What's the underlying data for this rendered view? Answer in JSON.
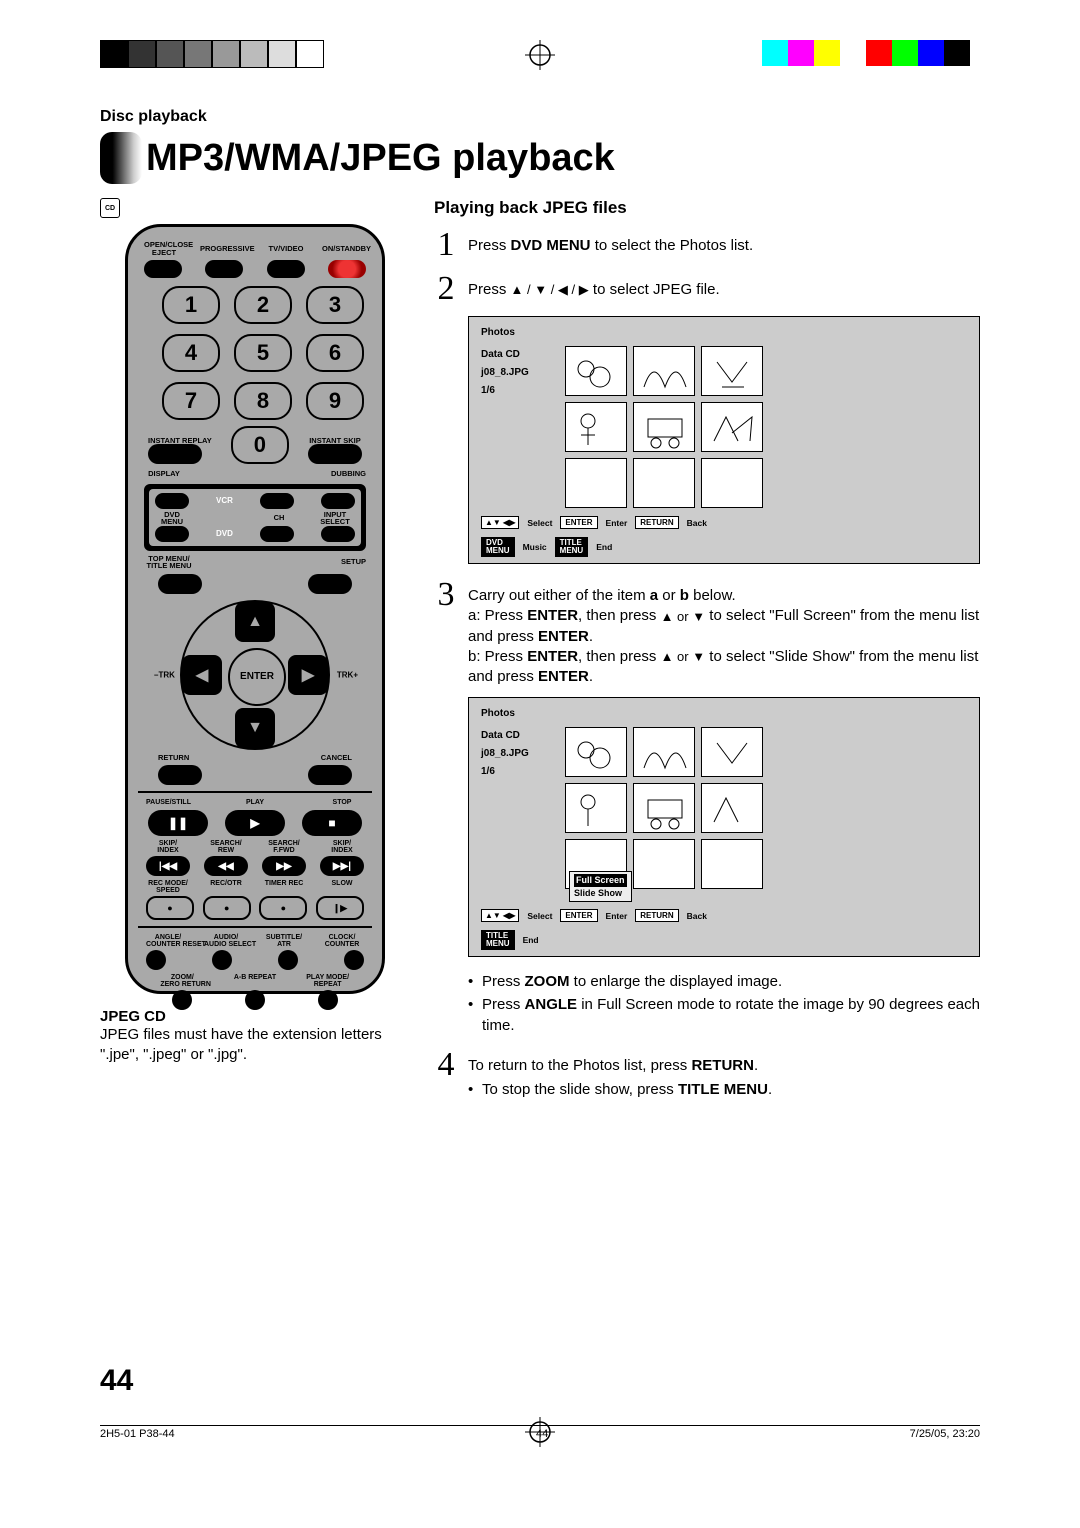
{
  "registration": {
    "mono_swatches": [
      "#000",
      "#333",
      "#555",
      "#777",
      "#999",
      "#bbb",
      "#ddd",
      "#fff"
    ],
    "color_swatches": [
      "#0ff",
      "#f0f",
      "#ff0",
      "#fff",
      "#f00",
      "#0f0",
      "#00f",
      "#000"
    ]
  },
  "header": {
    "section": "Disc playback",
    "title": "MP3/WMA/JPEG playback",
    "disc_badge": "CD"
  },
  "remote": {
    "top_labels": {
      "open_close": "OPEN/CLOSE",
      "eject": "EJECT",
      "progressive": "PROGRESSIVE",
      "tv_video": "TV/VIDEO",
      "on_standby": "ON/STANDBY"
    },
    "numbers": [
      "1",
      "2",
      "3",
      "4",
      "5",
      "6",
      "7",
      "8",
      "9"
    ],
    "zero": "0",
    "instant_replay": "INSTANT REPLAY",
    "instant_skip": "INSTANT SKIP",
    "display": "DISPLAY",
    "dubbing": "DUBBING",
    "vcr": "VCR",
    "dvd_menu": "DVD MENU",
    "ch": "CH",
    "input_select": "INPUT SELECT",
    "dvd": "DVD",
    "top_menu": "TOP MENU/\nTITLE MENU",
    "setup": "SETUP",
    "trk_minus": "–TRK",
    "enter": "ENTER",
    "trk_plus": "TRK+",
    "return": "RETURN",
    "cancel": "CANCEL",
    "transport": {
      "pause": "PAUSE/STILL",
      "play": "PLAY",
      "stop": "STOP"
    },
    "search": {
      "skip_index_l": "SKIP/\nINDEX",
      "search_rew": "SEARCH/\nREW",
      "search_fwd": "SEARCH/\nF.FWD",
      "skip_index_r": "SKIP/\nINDEX"
    },
    "rec_row": {
      "rec_mode": "REC MODE/\nSPEED",
      "rec_otr": "REC/OTR",
      "timer_rec": "TIMER REC",
      "slow": "SLOW"
    },
    "bottom_labels_1": {
      "angle": "ANGLE/\nCOUNTER RESET",
      "audio": "AUDIO/\nAUDIO SELECT",
      "subtitle": "SUBTITLE/\nATR",
      "clock": "CLOCK/\nCOUNTER"
    },
    "bottom_labels_2": {
      "zoom": "ZOOM/\nZERO RETURN",
      "ab": "A-B REPEAT",
      "play_mode": "PLAY MODE/\nREPEAT"
    }
  },
  "jpeg_cd": {
    "heading": "JPEG CD",
    "body": "JPEG files must have the extension letters \".jpe\", \".jpeg\" or \".jpg\"."
  },
  "right": {
    "subhead": "Playing back JPEG files",
    "step1": {
      "n": "1",
      "pre": "Press ",
      "b1": "DVD MENU",
      "post": " to select the Photos list."
    },
    "step2": {
      "n": "2",
      "pre": "Press ",
      "arrows": "▲ / ▼ / ◀ / ▶",
      "post": " to select JPEG file."
    },
    "osd1": {
      "title": "Photos",
      "left": {
        "l1": "Data CD",
        "l2": "j08_8.JPG",
        "l3": "1/6"
      },
      "footer": {
        "arrows": "▲▼ ◀▶",
        "select": "Select",
        "enter_key": "ENTER",
        "enter": "Enter",
        "return_key": "RETURN",
        "back": "Back",
        "dvd_menu_key": "DVD\nMENU",
        "music": "Music",
        "title_menu_key": "TITLE\nMENU",
        "end": "End"
      }
    },
    "step3": {
      "n": "3",
      "line1": "Carry out either of the item a or b below.",
      "a_pre": "a:  Press ",
      "a_b1": "ENTER",
      "a_mid1": ", then press ",
      "a_arrows": "▲ or ▼",
      "a_mid2": " to select \"Full Screen\" from the menu list and press ",
      "a_b2": "ENTER",
      "a_end": ".",
      "b_pre": "b:  Press ",
      "b_b1": "ENTER",
      "b_mid1": ", then press ",
      "b_arrows": "▲ or ▼",
      "b_mid2": " to select \"Slide Show\" from the menu list and press ",
      "b_b2": "ENTER",
      "b_end": "."
    },
    "osd2": {
      "title": "Photos",
      "left": {
        "l1": "Data CD",
        "l2": "j08_8.JPG",
        "l3": "1/6"
      },
      "menu": {
        "full": "Full Screen",
        "slide": "Slide Show"
      },
      "footer": {
        "arrows": "▲▼ ◀▶",
        "select": "Select",
        "enter_key": "ENTER",
        "enter": "Enter",
        "return_key": "RETURN",
        "back": "Back",
        "title_menu_key": "TITLE\nMENU",
        "end": "End"
      }
    },
    "bullets_a": [
      "Press ZOOM to enlarge the displayed image.",
      "Press ANGLE in Full Screen mode to rotate the image by 90 degrees each time."
    ],
    "step4": {
      "n": "4",
      "line1_pre": "To return to the Photos list, press ",
      "line1_b": "RETURN",
      "line1_end": ".",
      "bullet_pre": "To stop the slide show, press ",
      "bullet_b": "TITLE MENU",
      "bullet_end": "."
    }
  },
  "page_number": "44",
  "slug": {
    "file": "2H5-01 P38-44",
    "pg": "44",
    "date": "7/25/05, 23:20"
  }
}
